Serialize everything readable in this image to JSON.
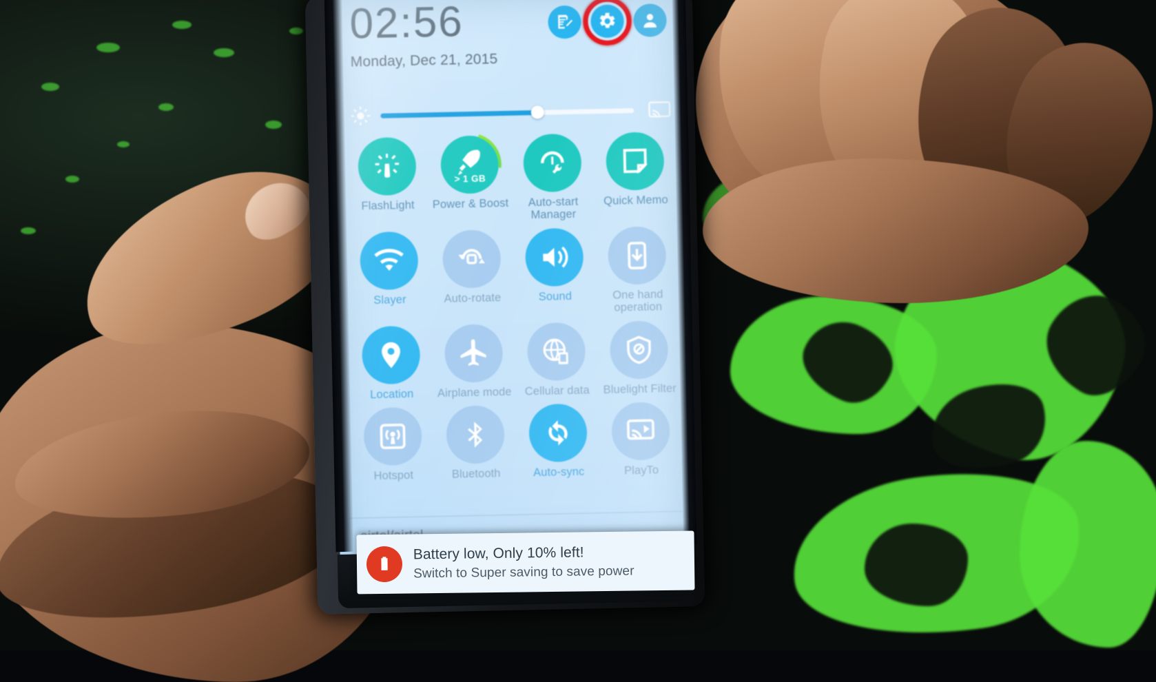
{
  "device": {
    "type": "android-phone",
    "view": "notification-shade-quick-settings"
  },
  "status": {
    "time": "02:56",
    "date": "Monday, Dec 21, 2015",
    "carrier": "airtel/airtel"
  },
  "header_icons": [
    {
      "name": "quick-note-icon",
      "label": "Quick note",
      "glyph": "note-edit"
    },
    {
      "name": "settings-gear-icon",
      "label": "Settings",
      "glyph": "gear",
      "highlighted": true,
      "highlight_color": "#e8171f"
    },
    {
      "name": "user-avatar-icon",
      "label": "User",
      "glyph": "avatar"
    }
  ],
  "brightness": {
    "label": "Brightness",
    "value_percent": 62,
    "auto_icon": "brightness-sun-icon",
    "cast_icon": "screen-cast-icon"
  },
  "toggles": [
    {
      "label": "FlashLight",
      "icon": "flashlight-icon",
      "state": "teal",
      "active": true
    },
    {
      "label": "Power & Boost",
      "icon": "boost-rocket-icon",
      "state": "teal",
      "active": true,
      "badge": "> 1 GB",
      "arc": true
    },
    {
      "label": "Auto-start Manager",
      "icon": "autostart-wrench-icon",
      "state": "teal",
      "active": true
    },
    {
      "label": "Quick Memo",
      "icon": "quick-memo-icon",
      "state": "teal",
      "active": true
    },
    {
      "label": "Slayer",
      "icon": "wifi-icon",
      "state": "on",
      "active": true
    },
    {
      "label": "Auto-rotate",
      "icon": "auto-rotate-icon",
      "state": "off",
      "active": false
    },
    {
      "label": "Sound",
      "icon": "sound-speaker-icon",
      "state": "on",
      "active": true
    },
    {
      "label": "One hand operation",
      "icon": "one-hand-icon",
      "state": "off",
      "active": false
    },
    {
      "label": "Location",
      "icon": "location-pin-icon",
      "state": "on",
      "active": true
    },
    {
      "label": "Airplane mode",
      "icon": "airplane-icon",
      "state": "off",
      "active": false
    },
    {
      "label": "Cellular data",
      "icon": "cellular-data-icon",
      "state": "off",
      "active": false
    },
    {
      "label": "Bluelight Filter",
      "icon": "bluelight-shield-icon",
      "state": "off",
      "active": false
    },
    {
      "label": "Hotspot",
      "icon": "hotspot-icon",
      "state": "off",
      "active": false
    },
    {
      "label": "Bluetooth",
      "icon": "bluetooth-icon",
      "state": "off",
      "active": false
    },
    {
      "label": "Auto-sync",
      "icon": "auto-sync-icon",
      "state": "on",
      "active": true
    },
    {
      "label": "PlayTo",
      "icon": "play-to-icon",
      "state": "off",
      "active": false
    }
  ],
  "notification": {
    "icon": "battery-low-icon",
    "icon_color": "#e03b22",
    "title": "Battery low, Only 10% left!",
    "subtitle": "Switch to Super saving to save power"
  },
  "colors": {
    "screen_bg": "#c9e5fa",
    "accent_on": "#33b9f2",
    "accent_teal": "#1fc9c0",
    "accent_off": "#a8cdf0",
    "highlight_ring": "#e8171f",
    "text_dim": "#86a9c6"
  }
}
